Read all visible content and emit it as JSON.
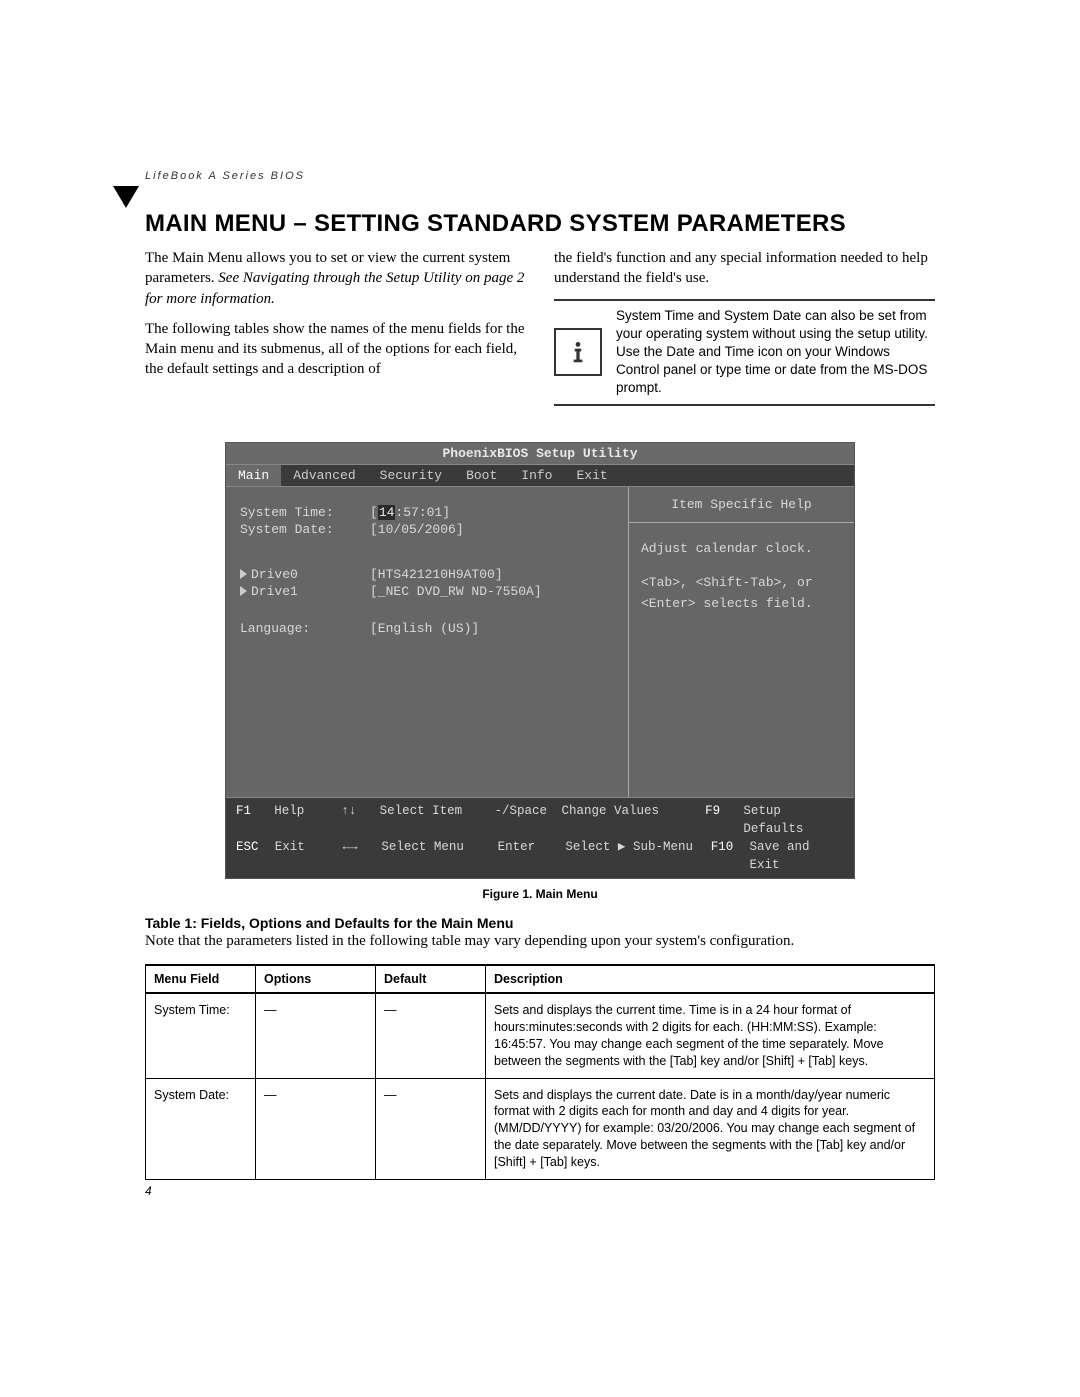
{
  "running_header": "LifeBook A Series BIOS",
  "title": "MAIN MENU – SETTING STANDARD SYSTEM PARAMETERS",
  "left_col": {
    "p1a": "The Main Menu allows you to set or view the current system parameters. ",
    "p1b": "See Navigating through the Setup Utility on page 2 for more information.",
    "p2": "The following tables show the names of the menu fields for the Main menu and its submenus, all of the options for each field, the default settings and a description of"
  },
  "right_col": {
    "p1": "the field's function and any special information needed to help understand the field's use.",
    "info": "System Time and System Date can also be set from your operating system without using the setup utility. Use the Date and Time icon on your Windows Control panel or type time or date from the MS-DOS prompt."
  },
  "bios": {
    "title": "PhoenixBIOS Setup Utility",
    "tabs": [
      "Main",
      "Advanced",
      "Security",
      "Boot",
      "Info",
      "Exit"
    ],
    "rows": {
      "time_label": "System Time:",
      "time_prefix": "[",
      "time_cursor": "14",
      "time_rest": ":57:01]",
      "date_label": "System Date:",
      "date_val": "[10/05/2006]",
      "drive0_label": "Drive0",
      "drive0_val": "[HTS421210H9AT00]",
      "drive1_label": "Drive1",
      "drive1_val": "[_NEC DVD_RW ND-7550A]",
      "lang_label": "Language:",
      "lang_val": "[English (US)]"
    },
    "help_title": "Item Specific Help",
    "help_body1": "Adjust calendar clock.",
    "help_body2": "<Tab>, <Shift-Tab>, or <Enter> selects field.",
    "footer": {
      "r1": {
        "k1": "F1",
        "v1": "Help",
        "k2": "↑↓",
        "v2": "Select Item",
        "k3": "-/Space",
        "v3": "Change Values",
        "k4": "F9",
        "v4": "Setup Defaults"
      },
      "r2": {
        "k1": "ESC",
        "v1": "Exit",
        "k2": "←→",
        "v2": "Select Menu",
        "k3": "Enter",
        "v3": "Select ▶ Sub-Menu",
        "k4": "F10",
        "v4": "Save and Exit"
      }
    }
  },
  "figure_caption": "Figure 1.  Main Menu",
  "table_title": "Table 1: Fields, Options and Defaults for the Main Menu",
  "table_note": "Note that the parameters listed in the following table may vary depending upon your system's configuration.",
  "table": {
    "headers": [
      "Menu Field",
      "Options",
      "Default",
      "Description"
    ],
    "rows": [
      {
        "field": "System Time:",
        "options": "—",
        "default_": "—",
        "desc": "Sets and displays the current time. Time is in a 24 hour format of hours:minutes:seconds with 2 digits for each. (HH:MM:SS). Example: 16:45:57. You may change each segment of the time separately. Move between the segments with the [Tab] key and/or [Shift] + [Tab] keys."
      },
      {
        "field": "System Date:",
        "options": "—",
        "default_": "—",
        "desc": "Sets and displays the current date. Date is in a month/day/year numeric format with 2 digits each for month and day and 4 digits for year. (MM/DD/YYYY) for example: 03/20/2006. You may change each segment of the date separately. Move between the segments with the [Tab] key and/or [Shift] + [Tab] keys."
      }
    ]
  },
  "page_num": "4"
}
